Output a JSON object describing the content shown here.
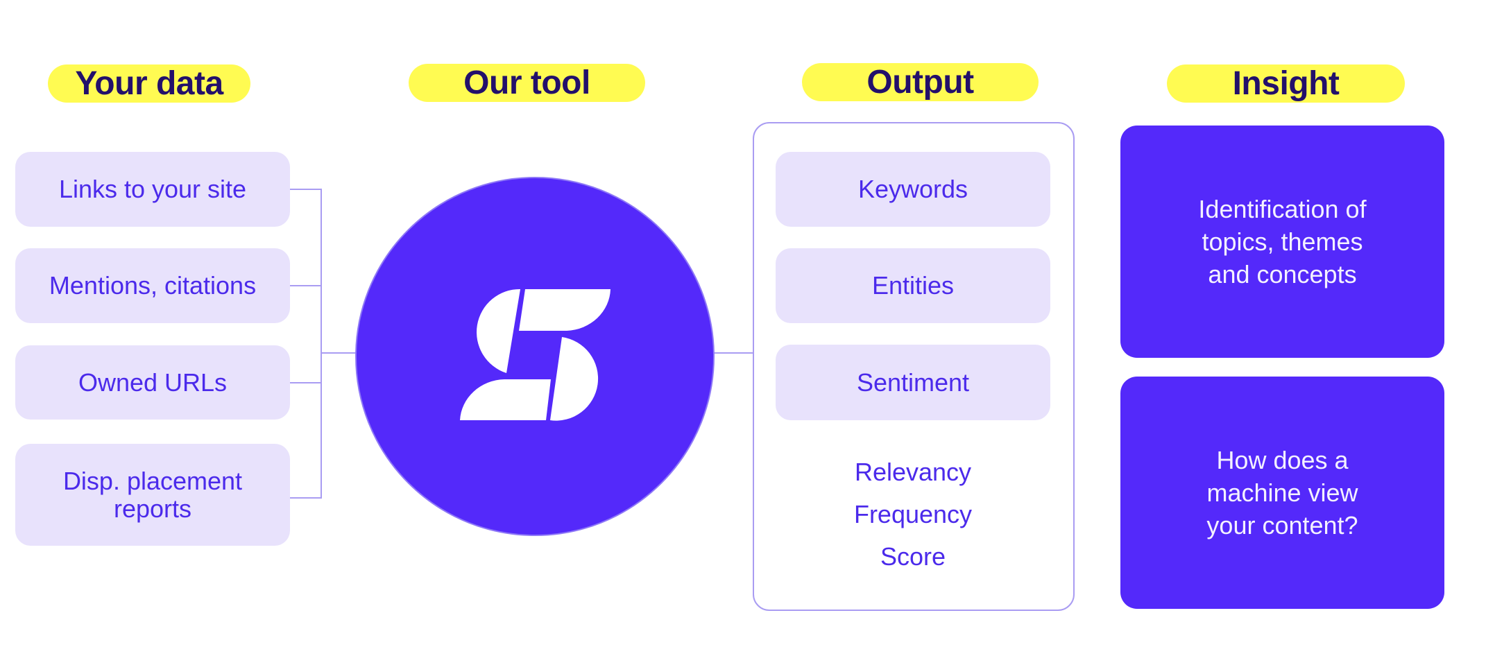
{
  "headers": {
    "your_data": "Your data",
    "our_tool": "Our tool",
    "output": "Output",
    "insight": "Insight"
  },
  "data_sources": [
    {
      "lines": [
        "Links to your site"
      ]
    },
    {
      "lines": [
        "Mentions, citations"
      ]
    },
    {
      "lines": [
        "Owned URLs"
      ]
    },
    {
      "lines": [
        "Disp. placement",
        "reports"
      ]
    }
  ],
  "tool": {
    "logo": "s-logo-icon"
  },
  "outputs": {
    "boxes": [
      "Keywords",
      "Entities",
      "Sentiment"
    ],
    "metrics": [
      "Relevancy",
      "Frequency",
      "Score"
    ]
  },
  "insights": [
    {
      "lines": [
        "Identification of",
        "topics, themes",
        "and concepts"
      ]
    },
    {
      "lines": [
        "How does a",
        "machine view",
        "your content?"
      ]
    }
  ],
  "colors": {
    "accent_purple": "#5429FA",
    "text_purple": "#4B2AEB",
    "box_lavender": "#E8E2FC",
    "header_yellow": "#FFFB52",
    "header_text": "#23106B",
    "connector": "#A99CF2"
  }
}
